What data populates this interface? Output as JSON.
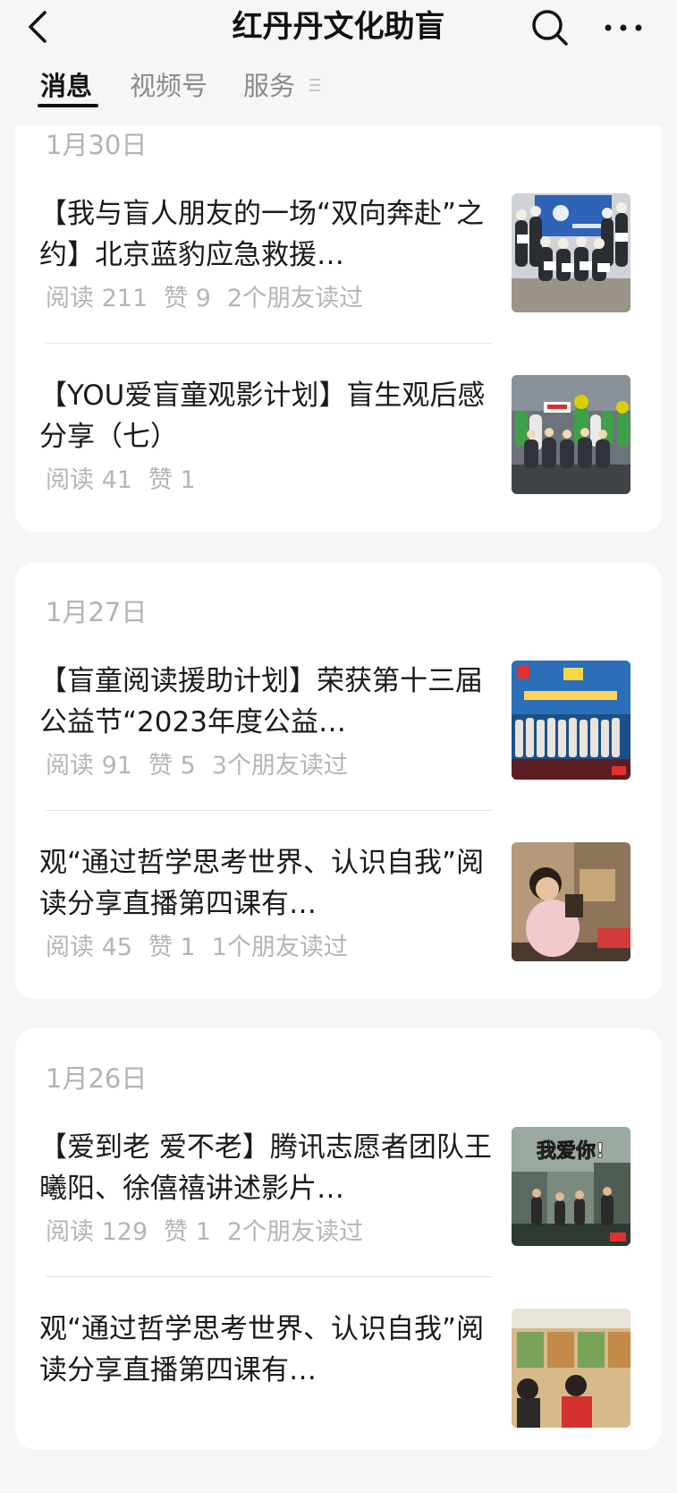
{
  "header": {
    "title": "红丹丹文化助盲",
    "back_icon": "chevron-left-icon",
    "search_icon": "search-icon",
    "more_icon": "more-dots-icon"
  },
  "tabs": [
    {
      "label": "消息",
      "active": true
    },
    {
      "label": "视频号",
      "active": false
    },
    {
      "label": "服务",
      "active": false,
      "has_menu_icon": true
    }
  ],
  "groups": [
    {
      "date": "1月30日",
      "articles": [
        {
          "title": "【我与盲人朋友的一场“双向奔赴”之约】北京蓝豹应急救援…",
          "reads": "阅读 211",
          "likes": "赞 9",
          "friends": "2个朋友读过",
          "thumb_desc": "group-photo-blue-banner"
        },
        {
          "title": "【YOU爱盲童观影计划】盲生观后感分享（七）",
          "reads": "阅读 41",
          "likes": "赞 1",
          "friends": "",
          "thumb_desc": "children-group-photo"
        }
      ]
    },
    {
      "date": "1月27日",
      "articles": [
        {
          "title": "【盲童阅读援助计划】荣获第十三届公益节“2023年度公益…",
          "reads": "阅读 91",
          "likes": "赞 5",
          "friends": "3个朋友读过",
          "thumb_desc": "award-stage-photo"
        },
        {
          "title": "观“通过哲学思考世界、认识自我”阅读分享直播第四课有…",
          "reads": "阅读 45",
          "likes": "赞 1",
          "friends": "1个朋友读过",
          "thumb_desc": "girl-reading-photo"
        }
      ]
    },
    {
      "date": "1月26日",
      "articles": [
        {
          "title": "【爱到老 爱不老】腾讯志愿者团队王曦阳、徐僖禧讲述影片…",
          "reads": "阅读 129",
          "likes": "赞 1",
          "friends": "2个朋友读过",
          "thumb_desc": "movie-poster-photo",
          "poster_text": "我爱你!"
        },
        {
          "title": "观“通过哲学思考世界、认识自我”阅读分享直播第四课有…",
          "reads": "",
          "likes": "",
          "friends": "",
          "thumb_desc": "classroom-photo"
        }
      ]
    }
  ]
}
